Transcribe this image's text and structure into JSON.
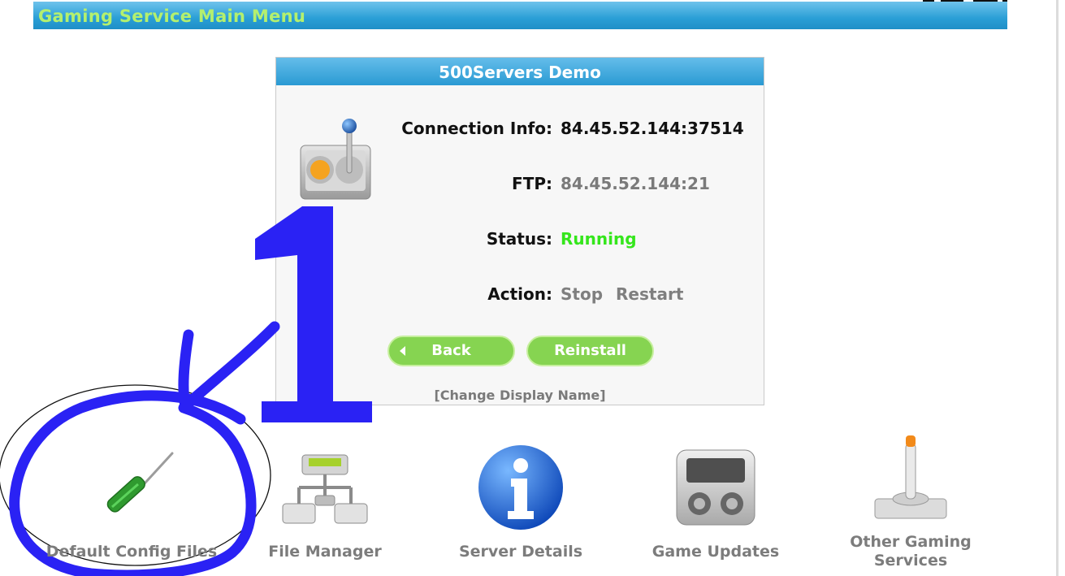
{
  "header": {
    "title": "Gaming Service Main Menu"
  },
  "server_panel": {
    "title": "500Servers Demo",
    "connection": {
      "label": "Connection Info:",
      "value": "84.45.52.144:37514"
    },
    "ftp": {
      "label": "FTP:",
      "value": "84.45.52.144:21"
    },
    "status": {
      "label": "Status:",
      "value": "Running"
    },
    "action": {
      "label": "Action:",
      "stop": "Stop",
      "restart": "Restart"
    },
    "buttons": {
      "back": "Back",
      "reinstall": "Reinstall"
    },
    "change_name": "[Change Display Name]"
  },
  "services": [
    {
      "label": "Default Config Files",
      "icon": "screwdriver-icon"
    },
    {
      "label": "File Manager",
      "icon": "network-drive-icon"
    },
    {
      "label": "Server Details",
      "icon": "info-icon"
    },
    {
      "label": "Game Updates",
      "icon": "console-icon"
    },
    {
      "label": "Other Gaming Services",
      "icon": "joystick-icon"
    }
  ],
  "annotation": {
    "number": "1",
    "color": "#2a22f4"
  },
  "colors": {
    "header_title": "#b4f06e",
    "header_bar": "#2a9fd6",
    "status_running": "#35e61c",
    "button_green": "#86d451",
    "link_gray": "#7f7f7f"
  }
}
